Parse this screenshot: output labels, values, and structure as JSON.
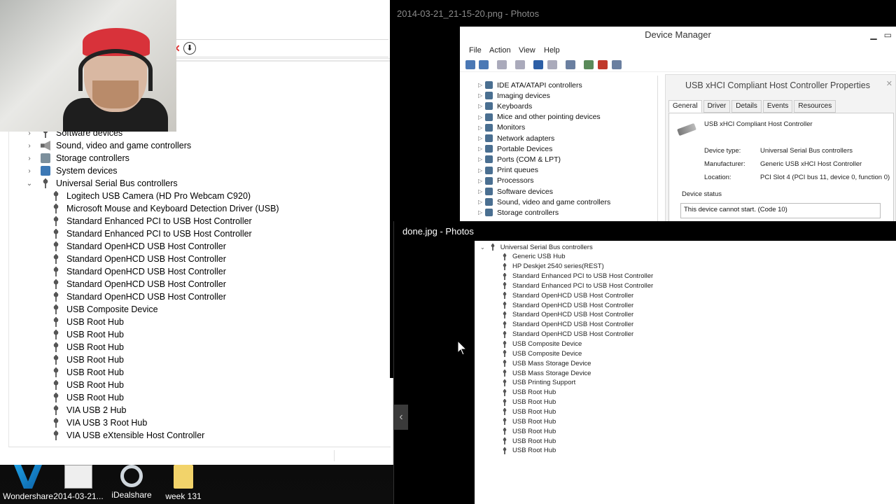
{
  "left_window": {
    "tree": [
      {
        "label": "Software devices",
        "type": "category"
      },
      {
        "label": "Sound, video and game controllers",
        "type": "category"
      },
      {
        "label": "Storage controllers",
        "type": "category"
      },
      {
        "label": "System devices",
        "type": "category"
      },
      {
        "label": "Universal Serial Bus controllers",
        "type": "expanded"
      },
      {
        "label": "Logitech USB Camera (HD Pro Webcam C920)",
        "type": "device"
      },
      {
        "label": "Microsoft Mouse and Keyboard Detection Driver (USB)",
        "type": "device"
      },
      {
        "label": "Standard Enhanced PCI to USB Host Controller",
        "type": "device"
      },
      {
        "label": "Standard Enhanced PCI to USB Host Controller",
        "type": "device"
      },
      {
        "label": "Standard OpenHCD USB Host Controller",
        "type": "device"
      },
      {
        "label": "Standard OpenHCD USB Host Controller",
        "type": "device"
      },
      {
        "label": "Standard OpenHCD USB Host Controller",
        "type": "device"
      },
      {
        "label": "Standard OpenHCD USB Host Controller",
        "type": "device"
      },
      {
        "label": "Standard OpenHCD USB Host Controller",
        "type": "device"
      },
      {
        "label": "USB Composite Device",
        "type": "device"
      },
      {
        "label": "USB Root Hub",
        "type": "device"
      },
      {
        "label": "USB Root Hub",
        "type": "device"
      },
      {
        "label": "USB Root Hub",
        "type": "device"
      },
      {
        "label": "USB Root Hub",
        "type": "device"
      },
      {
        "label": "USB Root Hub",
        "type": "device"
      },
      {
        "label": "USB Root Hub",
        "type": "device"
      },
      {
        "label": "USB Root Hub",
        "type": "device"
      },
      {
        "label": "VIA USB 2 Hub",
        "type": "device"
      },
      {
        "label": "VIA USB 3 Root Hub",
        "type": "device"
      },
      {
        "label": "VIA USB eXtensible Host Controller",
        "type": "device"
      }
    ]
  },
  "desktop_icons": [
    {
      "label": "Wondershare"
    },
    {
      "label": "2014-03-21..."
    },
    {
      "label": "iDealshare"
    },
    {
      "label": "week 131"
    }
  ],
  "photos1": {
    "title": "2014-03-21_21-15-20.png - Photos",
    "dm_title": "Device Manager",
    "menu": [
      "File",
      "Action",
      "View",
      "Help"
    ],
    "tree": [
      "IDE ATA/ATAPI controllers",
      "Imaging devices",
      "Keyboards",
      "Mice and other pointing devices",
      "Monitors",
      "Network adapters",
      "Portable Devices",
      "Ports (COM & LPT)",
      "Print queues",
      "Processors",
      "Software devices",
      "Sound, video and game controllers",
      "Storage controllers"
    ],
    "props": {
      "title": "USB xHCI Compliant Host Controller Properties",
      "tabs": [
        "General",
        "Driver",
        "Details",
        "Events",
        "Resources"
      ],
      "device_name": "USB xHCI Compliant Host Controller",
      "type_label": "Device type:",
      "type_value": "Universal Serial Bus controllers",
      "mfr_label": "Manufacturer:",
      "mfr_value": "Generic USB xHCI Host Controller",
      "loc_label": "Location:",
      "loc_value": "PCI Slot 4 (PCI bus 11, device 0, function 0)",
      "status_label": "Device status",
      "status_value": "This device cannot start. (Code 10)"
    }
  },
  "photos2": {
    "title": "done.jpg - Photos",
    "tree": [
      "Universal Serial Bus controllers",
      "Generic USB Hub",
      "HP Deskjet 2540 series(REST)",
      "Standard Enhanced PCI to USB Host Controller",
      "Standard Enhanced PCI to USB Host Controller",
      "Standard OpenHCD USB Host Controller",
      "Standard OpenHCD USB Host Controller",
      "Standard OpenHCD USB Host Controller",
      "Standard OpenHCD USB Host Controller",
      "Standard OpenHCD USB Host Controller",
      "USB Composite Device",
      "USB Composite Device",
      "USB Mass Storage Device",
      "USB Mass Storage Device",
      "USB Printing Support",
      "USB Root Hub",
      "USB Root Hub",
      "USB Root Hub",
      "USB Root Hub",
      "USB Root Hub",
      "USB Root Hub",
      "USB Root Hub"
    ],
    "nav_glyph": "‹"
  }
}
